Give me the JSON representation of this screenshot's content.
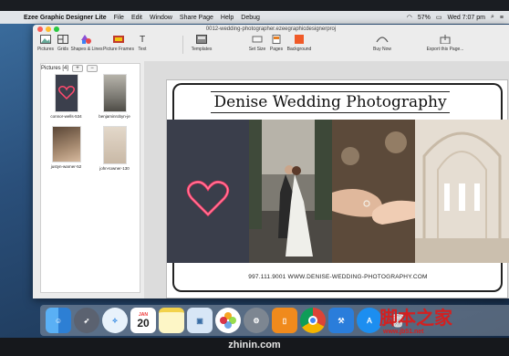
{
  "menubar": {
    "app_name": "Ezee Graphic Designer Lite",
    "items": [
      "File",
      "Edit",
      "Window",
      "Share Page",
      "Help",
      "Debug"
    ],
    "battery": "57%",
    "clock": "Wed 7:07 pm"
  },
  "window": {
    "title": "0012-wedding-photographer.ezeegraphicdesignerproj"
  },
  "toolbar": {
    "tools": [
      {
        "label": "Pictures",
        "icon": "pictures-icon"
      },
      {
        "label": "Grids",
        "icon": "grid-icon"
      },
      {
        "label": "Shapes & Lines",
        "icon": "shapes-icon"
      },
      {
        "label": "Picture Frames",
        "icon": "picture-frames-icon"
      },
      {
        "label": "Text",
        "icon": "text-icon"
      }
    ],
    "middle": [
      {
        "label": "Templates",
        "icon": "templates-icon"
      },
      {
        "label": "Set Size",
        "icon": "set-size-icon"
      },
      {
        "label": "Pages",
        "icon": "pages-icon"
      },
      {
        "label": "Background",
        "icon": "background-icon"
      }
    ],
    "right": [
      {
        "label": "Buy Now",
        "icon": "buy-now-icon"
      },
      {
        "label": "Export this Page...",
        "icon": "export-icon"
      }
    ]
  },
  "panel": {
    "title": "Pictures [4]",
    "add_label": "+",
    "remove_label": "−",
    "pictures": [
      {
        "caption": "connor-wells-534",
        "color": "#3b3f4c"
      },
      {
        "caption": "benjaminrobyn-je",
        "color": "#8a8b85"
      },
      {
        "caption": "justyn-warner-52",
        "color": "#9a7f69"
      },
      {
        "caption": "john-towner-130",
        "color": "#d8cdc0"
      }
    ]
  },
  "page": {
    "title": "Denise Wedding Photography",
    "footer": "997.111.9001 WWW.DENISE-WEDDING-PHOTOGRAPHY.COM"
  },
  "dock": {
    "calendar_month": "JAN",
    "calendar_day": "20"
  },
  "laptop_label": "zhinin.com",
  "watermark": {
    "text": "脚本之家",
    "url": "www.jb51.net"
  }
}
